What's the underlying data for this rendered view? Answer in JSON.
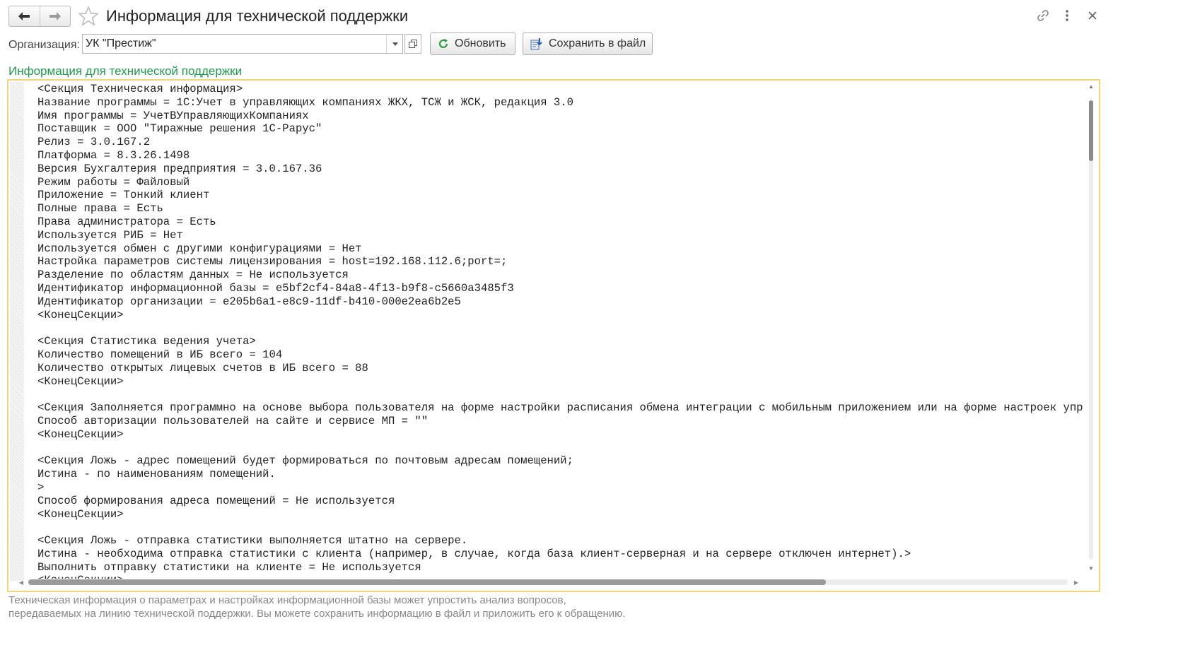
{
  "window": {
    "title": "Информация для технической поддержки"
  },
  "toolbar": {
    "organization_label": "Организация:",
    "organization_value": "УК \"Престиж\"",
    "refresh_label": "Обновить",
    "save_label": "Сохранить в файл"
  },
  "section": {
    "title": "Информация для технической поддержки"
  },
  "report": {
    "lines": [
      "<Секция Техническая информация>",
      "Название программы = 1С:Учет в управляющих компаниях ЖКХ, ТСЖ и ЖСК, редакция 3.0",
      "Имя программы = УчетВУправляющихКомпаниях",
      "Поставщик = ООО \"Тиражные решения 1С-Рарус\"",
      "Релиз = 3.0.167.2",
      "Платформа = 8.3.26.1498",
      "Версия Бухгалтерия предприятия = 3.0.167.36",
      "Режим работы = Файловый",
      "Приложение = Тонкий клиент",
      "Полные права = Есть",
      "Права администратора = Есть",
      "Используется РИБ = Нет",
      "Используется обмен с другими конфигурациями = Нет",
      "Настройка параметров системы лицензирования = host=192.168.112.6;port=;",
      "Разделение по областям данных = Не используется",
      "Идентификатор информационной базы = e5bf2cf4-84a8-4f13-b9f8-c5660a3485f3",
      "Идентификатор организации = e205b6a1-e8c9-11df-b410-000e2ea6b2e5",
      "<КонецСекции>",
      "",
      "<Секция Статистика ведения учета>",
      "Количество помещений в ИБ всего = 104",
      "Количество открытых лицевых счетов в ИБ всего = 88",
      "<КонецСекции>",
      "",
      "<Секция Заполняется программно на основе выбора пользователя на форме настройки расписания обмена интеграции с мобильным приложением или на форме настроек упр",
      "Способ авторизации пользователей на сайте и сервисе МП = \"\"",
      "<КонецСекции>",
      "",
      "<Секция Ложь - адрес помещений будет формироваться по почтовым адресам помещений;",
      "Истина - по наименованиям помещений.",
      ">",
      "Способ формирования адреса помещений = Не используется",
      "<КонецСекции>",
      "",
      "<Секция Ложь - отправка статистики выполняется штатно на сервере.",
      "Истина - необходима отправка статистики с клиента (например, в случае, когда база клиент-серверная и на сервере отключен интернет).>",
      "Выполнить отправку статистики на клиенте = Не используется",
      "<КонецСекции>"
    ]
  },
  "footer": {
    "line1": "Техническая информация о параметрах и настройках информационной базы может упростить анализ вопросов,",
    "line2": "передаваемых на линию технической поддержки. Вы можете сохранить информацию в файл и приложить его к обращению."
  },
  "colors": {
    "section_title": "#1e9a4c",
    "frame_border": "#f0d57a",
    "refresh_icon": "#2e9a3e"
  }
}
